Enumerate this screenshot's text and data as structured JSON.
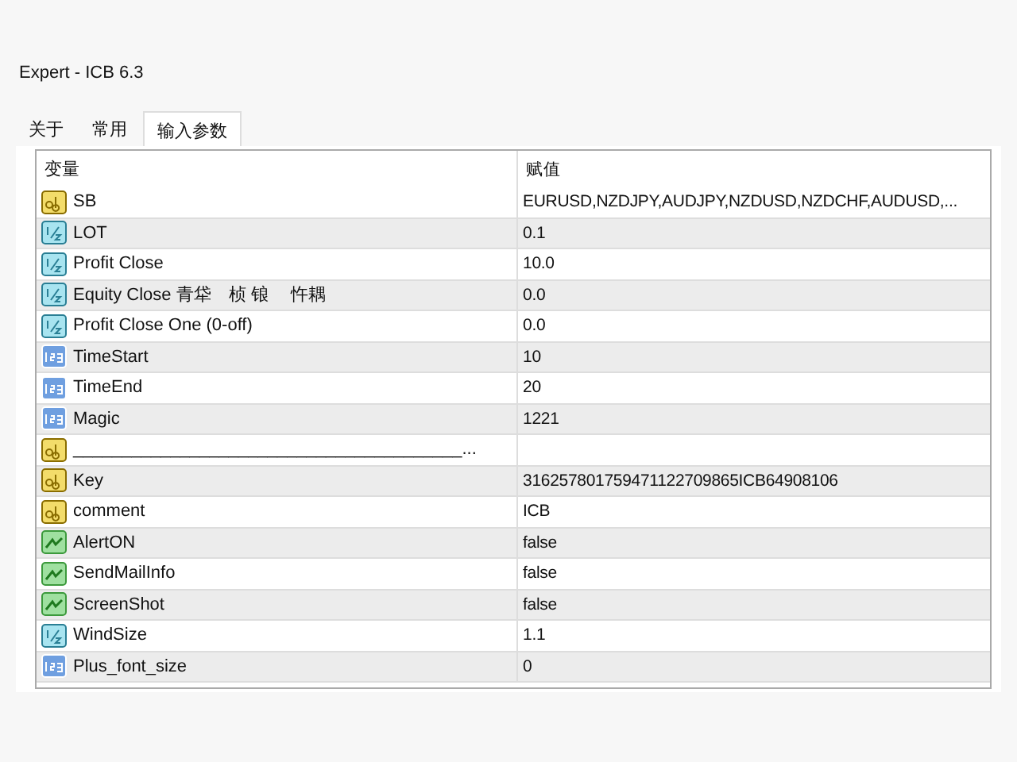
{
  "window": {
    "title": "Expert - ICB 6.3"
  },
  "tabs": [
    {
      "label": "关于",
      "selected": false
    },
    {
      "label": "常用",
      "selected": false
    },
    {
      "label": "输入参数",
      "selected": true
    }
  ],
  "table": {
    "columns": [
      "变量",
      "赋值"
    ],
    "rows": [
      {
        "kind": "string",
        "name": "SB",
        "value": "EURUSD,NZDJPY,AUDJPY,NZDUSD,NZDCHF,AUDUSD,..."
      },
      {
        "kind": "double",
        "name": "LOT",
        "value": "0.1"
      },
      {
        "kind": "double",
        "name": "Profit Close",
        "value": "10.0"
      },
      {
        "kind": "double",
        "name": "Equity Close 青牮　桢 锒　 忤耦",
        "value": "0.0"
      },
      {
        "kind": "double",
        "name": "Profit Close One (0-off)",
        "value": "0.0"
      },
      {
        "kind": "int",
        "name": "TimeStart",
        "value": "10"
      },
      {
        "kind": "int",
        "name": "TimeEnd",
        "value": "20"
      },
      {
        "kind": "int",
        "name": "Magic",
        "value": "1221"
      },
      {
        "kind": "string",
        "name": "________________________________________..."
      },
      {
        "kind": "string",
        "name": "Key",
        "value": "316257801759471122709865ICB64908106"
      },
      {
        "kind": "string",
        "name": "comment",
        "value": "ICB"
      },
      {
        "kind": "bool",
        "name": "AlertON",
        "value": "false"
      },
      {
        "kind": "bool",
        "name": "SendMailInfo",
        "value": "false"
      },
      {
        "kind": "bool",
        "name": "ScreenShot",
        "value": "false"
      },
      {
        "kind": "double",
        "name": "WindSize",
        "value": "1.1"
      },
      {
        "kind": "int",
        "name": "Plus_font_size",
        "value": "0"
      }
    ]
  }
}
